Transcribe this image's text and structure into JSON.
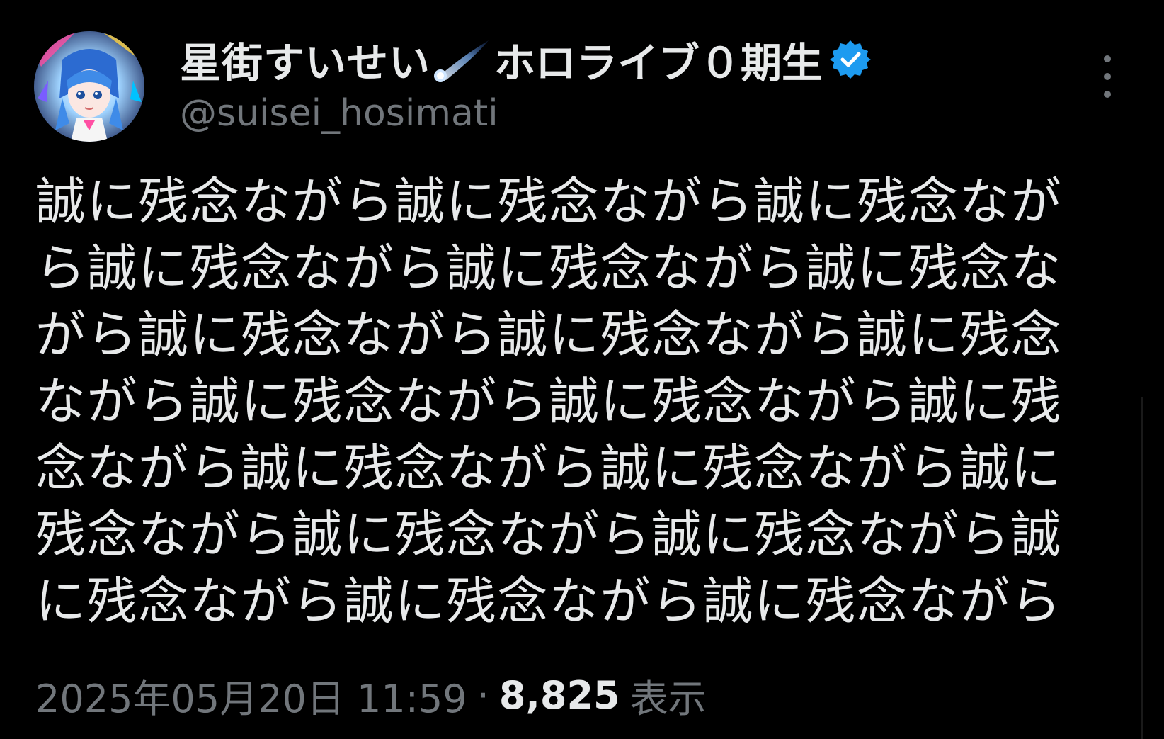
{
  "post": {
    "author": {
      "display_name": "星街すいせい",
      "display_name_suffix": "ホロライブ０期生",
      "handle": "@suisei_hosimati",
      "verified": true
    },
    "text_lines": [
      "誠に残念ながら誠に残念ながら誠に残念なが",
      "ら誠に残念ながら誠に残念ながら誠に残念な",
      "がら誠に残念ながら誠に残念ながら誠に残念",
      "ながら誠に残念ながら誠に残念ながら誠に残",
      "念ながら誠に残念ながら誠に残念ながら誠に",
      "残念ながら誠に残念ながら誠に残念ながら誠",
      "に残念ながら誠に残念ながら誠に残念ながら"
    ],
    "timestamp": "2025年05月20日 11:59",
    "separator": "·",
    "views": {
      "count": "8,825",
      "label": "表示"
    }
  },
  "icons": {
    "name_emoji": "comet-icon",
    "verified": "verified-badge-icon",
    "more": "more-vertical-icon"
  },
  "colors": {
    "background": "#000000",
    "primary_text": "#e7e9ea",
    "secondary_text": "#71767b",
    "verified_badge": "#1d9bf0"
  }
}
